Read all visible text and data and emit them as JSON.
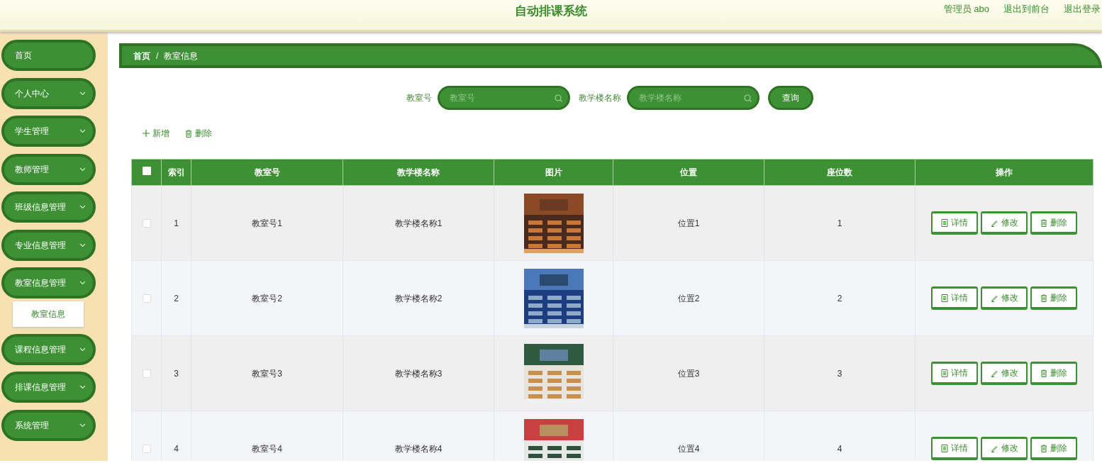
{
  "header": {
    "title": "自动排课系统",
    "user": "管理员 abo",
    "links": [
      "退出到前台",
      "退出登录"
    ]
  },
  "sidebar": {
    "items": [
      {
        "label": "首页",
        "expandable": false
      },
      {
        "label": "个人中心",
        "expandable": true,
        "expanded": false
      },
      {
        "label": "学生管理",
        "expandable": true,
        "expanded": false
      },
      {
        "label": "教师管理",
        "expandable": true,
        "expanded": false
      },
      {
        "label": "班级信息管理",
        "expandable": true,
        "expanded": false
      },
      {
        "label": "专业信息管理",
        "expandable": true,
        "expanded": false
      },
      {
        "label": "教室信息管理",
        "expandable": true,
        "expanded": true,
        "children": [
          {
            "label": "教室信息",
            "selected": true
          }
        ]
      },
      {
        "label": "课程信息管理",
        "expandable": true,
        "expanded": false
      },
      {
        "label": "排课信息管理",
        "expandable": true,
        "expanded": false
      },
      {
        "label": "系统管理",
        "expandable": true,
        "expanded": false
      }
    ]
  },
  "breadcrumb": {
    "separator": "/",
    "items": [
      "首页",
      "教室信息"
    ]
  },
  "search": {
    "fields": [
      {
        "label": "教室号",
        "placeholder": "教室号"
      },
      {
        "label": "教学楼名称",
        "placeholder": "教学楼名称"
      }
    ],
    "button": "查询"
  },
  "actions": [
    {
      "kind": "add",
      "label": "新增"
    },
    {
      "kind": "delete",
      "label": "删除"
    }
  ],
  "table": {
    "select_all": {
      "checked": false
    },
    "columns": [
      "索引",
      "教室号",
      "教学楼名称",
      "图片",
      "位置",
      "座位数",
      "操作"
    ],
    "rows": [
      {
        "checked": false,
        "cells": [
          "1",
          "教室号1",
          "教学楼名称1"
        ],
        "cells_after": [
          "位置1",
          "1"
        ],
        "buttons": [
          {
            "kind": "detail",
            "label": "详情"
          },
          {
            "kind": "edit",
            "label": "修改"
          },
          {
            "kind": "delete",
            "label": "删除"
          }
        ]
      },
      {
        "checked": false,
        "cells": [
          "2",
          "教室号2",
          "教学楼名称2"
        ],
        "cells_after": [
          "位置2",
          "2"
        ],
        "buttons": [
          {
            "kind": "detail",
            "label": "详情"
          },
          {
            "kind": "edit",
            "label": "修改"
          },
          {
            "kind": "delete",
            "label": "删除"
          }
        ]
      },
      {
        "checked": false,
        "cells": [
          "3",
          "教室号3",
          "教学楼名称3"
        ],
        "cells_after": [
          "位置3",
          "3"
        ],
        "buttons": [
          {
            "kind": "detail",
            "label": "详情"
          },
          {
            "kind": "edit",
            "label": "修改"
          },
          {
            "kind": "delete",
            "label": "删除"
          }
        ]
      },
      {
        "checked": false,
        "cells": [
          "4",
          "教室号4",
          "教学楼名称4"
        ],
        "cells_after": [
          "位置4",
          "4"
        ],
        "buttons": [
          {
            "kind": "detail",
            "label": "详情"
          },
          {
            "kind": "edit",
            "label": "修改"
          },
          {
            "kind": "delete",
            "label": "删除"
          }
        ]
      }
    ]
  }
}
